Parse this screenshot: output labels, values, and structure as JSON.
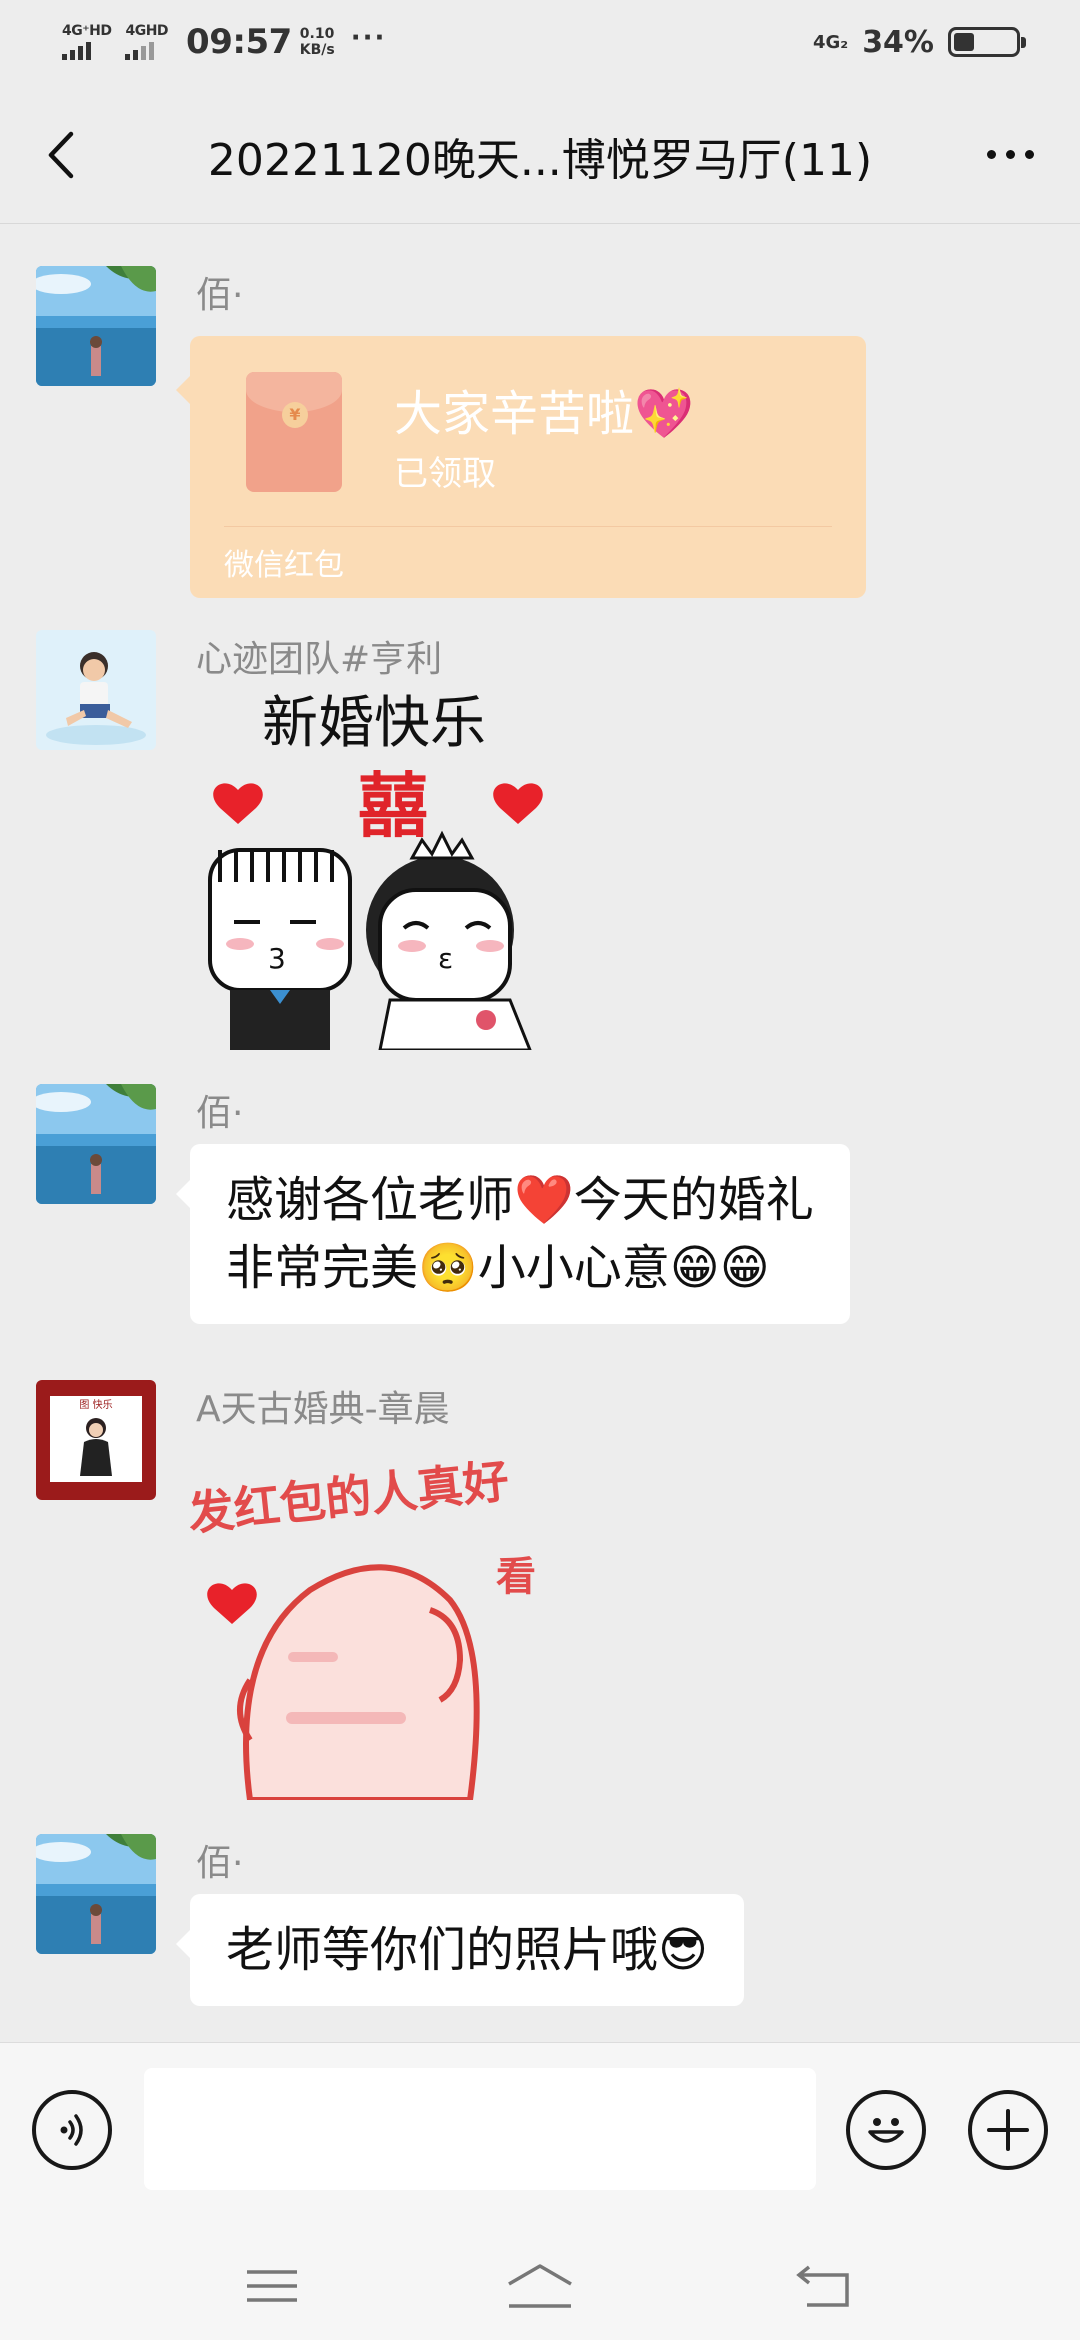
{
  "status_bar": {
    "sim1_label": "4G⁺HD",
    "sim2_label": "4GHD",
    "time": "09:57",
    "speed_value": "0.10",
    "speed_unit": "KB/s",
    "more_dots": "···",
    "network": "4G₂",
    "battery_percent": "34%",
    "battery_level": 0.34
  },
  "header": {
    "title": "20221120晚天...博悦罗马厅(11)"
  },
  "messages": [
    {
      "sender": "佰·",
      "type": "red_packet",
      "red_packet": {
        "title": "大家辛苦啦💖",
        "status": "已领取",
        "footer": "微信红包",
        "coin": "¥"
      }
    },
    {
      "sender": "心迹团队#亨利",
      "type": "sticker",
      "sticker_text": [
        "新婚快乐",
        "囍"
      ]
    },
    {
      "sender": "佰·",
      "type": "text",
      "lines": [
        "感谢各位老师❤️今天的婚礼",
        "非常完美🥺小小心意😁😁"
      ]
    },
    {
      "sender": "A天古婚典-章晨",
      "type": "sticker",
      "sticker_text": [
        "发红包的人真好",
        "看"
      ],
      "avatar_text": "图 快乐"
    },
    {
      "sender": "佰·",
      "type": "text",
      "lines": [
        "老师等你们的照片哦😎"
      ]
    }
  ],
  "colors": {
    "background": "#ededed",
    "red_packet": "#fbdcb6",
    "bubble": "#ffffff"
  },
  "icons": {
    "back": "chevron-left-icon",
    "more": "more-dots-icon",
    "voice": "voice-icon",
    "emoji": "emoji-icon",
    "add": "plus-icon",
    "menu": "menu-icon",
    "home": "home-icon",
    "back_nav": "back-arrow-icon"
  }
}
